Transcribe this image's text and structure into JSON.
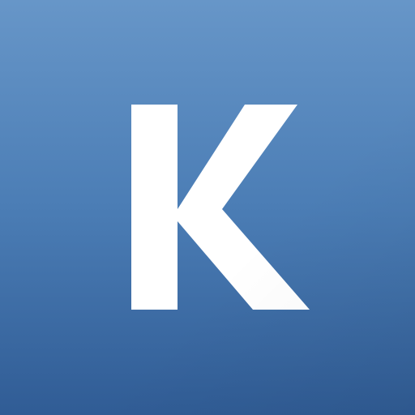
{
  "icon": {
    "letter": "K",
    "colors": {
      "gradient_top": "#6796c8",
      "gradient_mid": "#4b7db5",
      "gradient_bottom": "#305c95",
      "letter": "#ffffff"
    }
  }
}
